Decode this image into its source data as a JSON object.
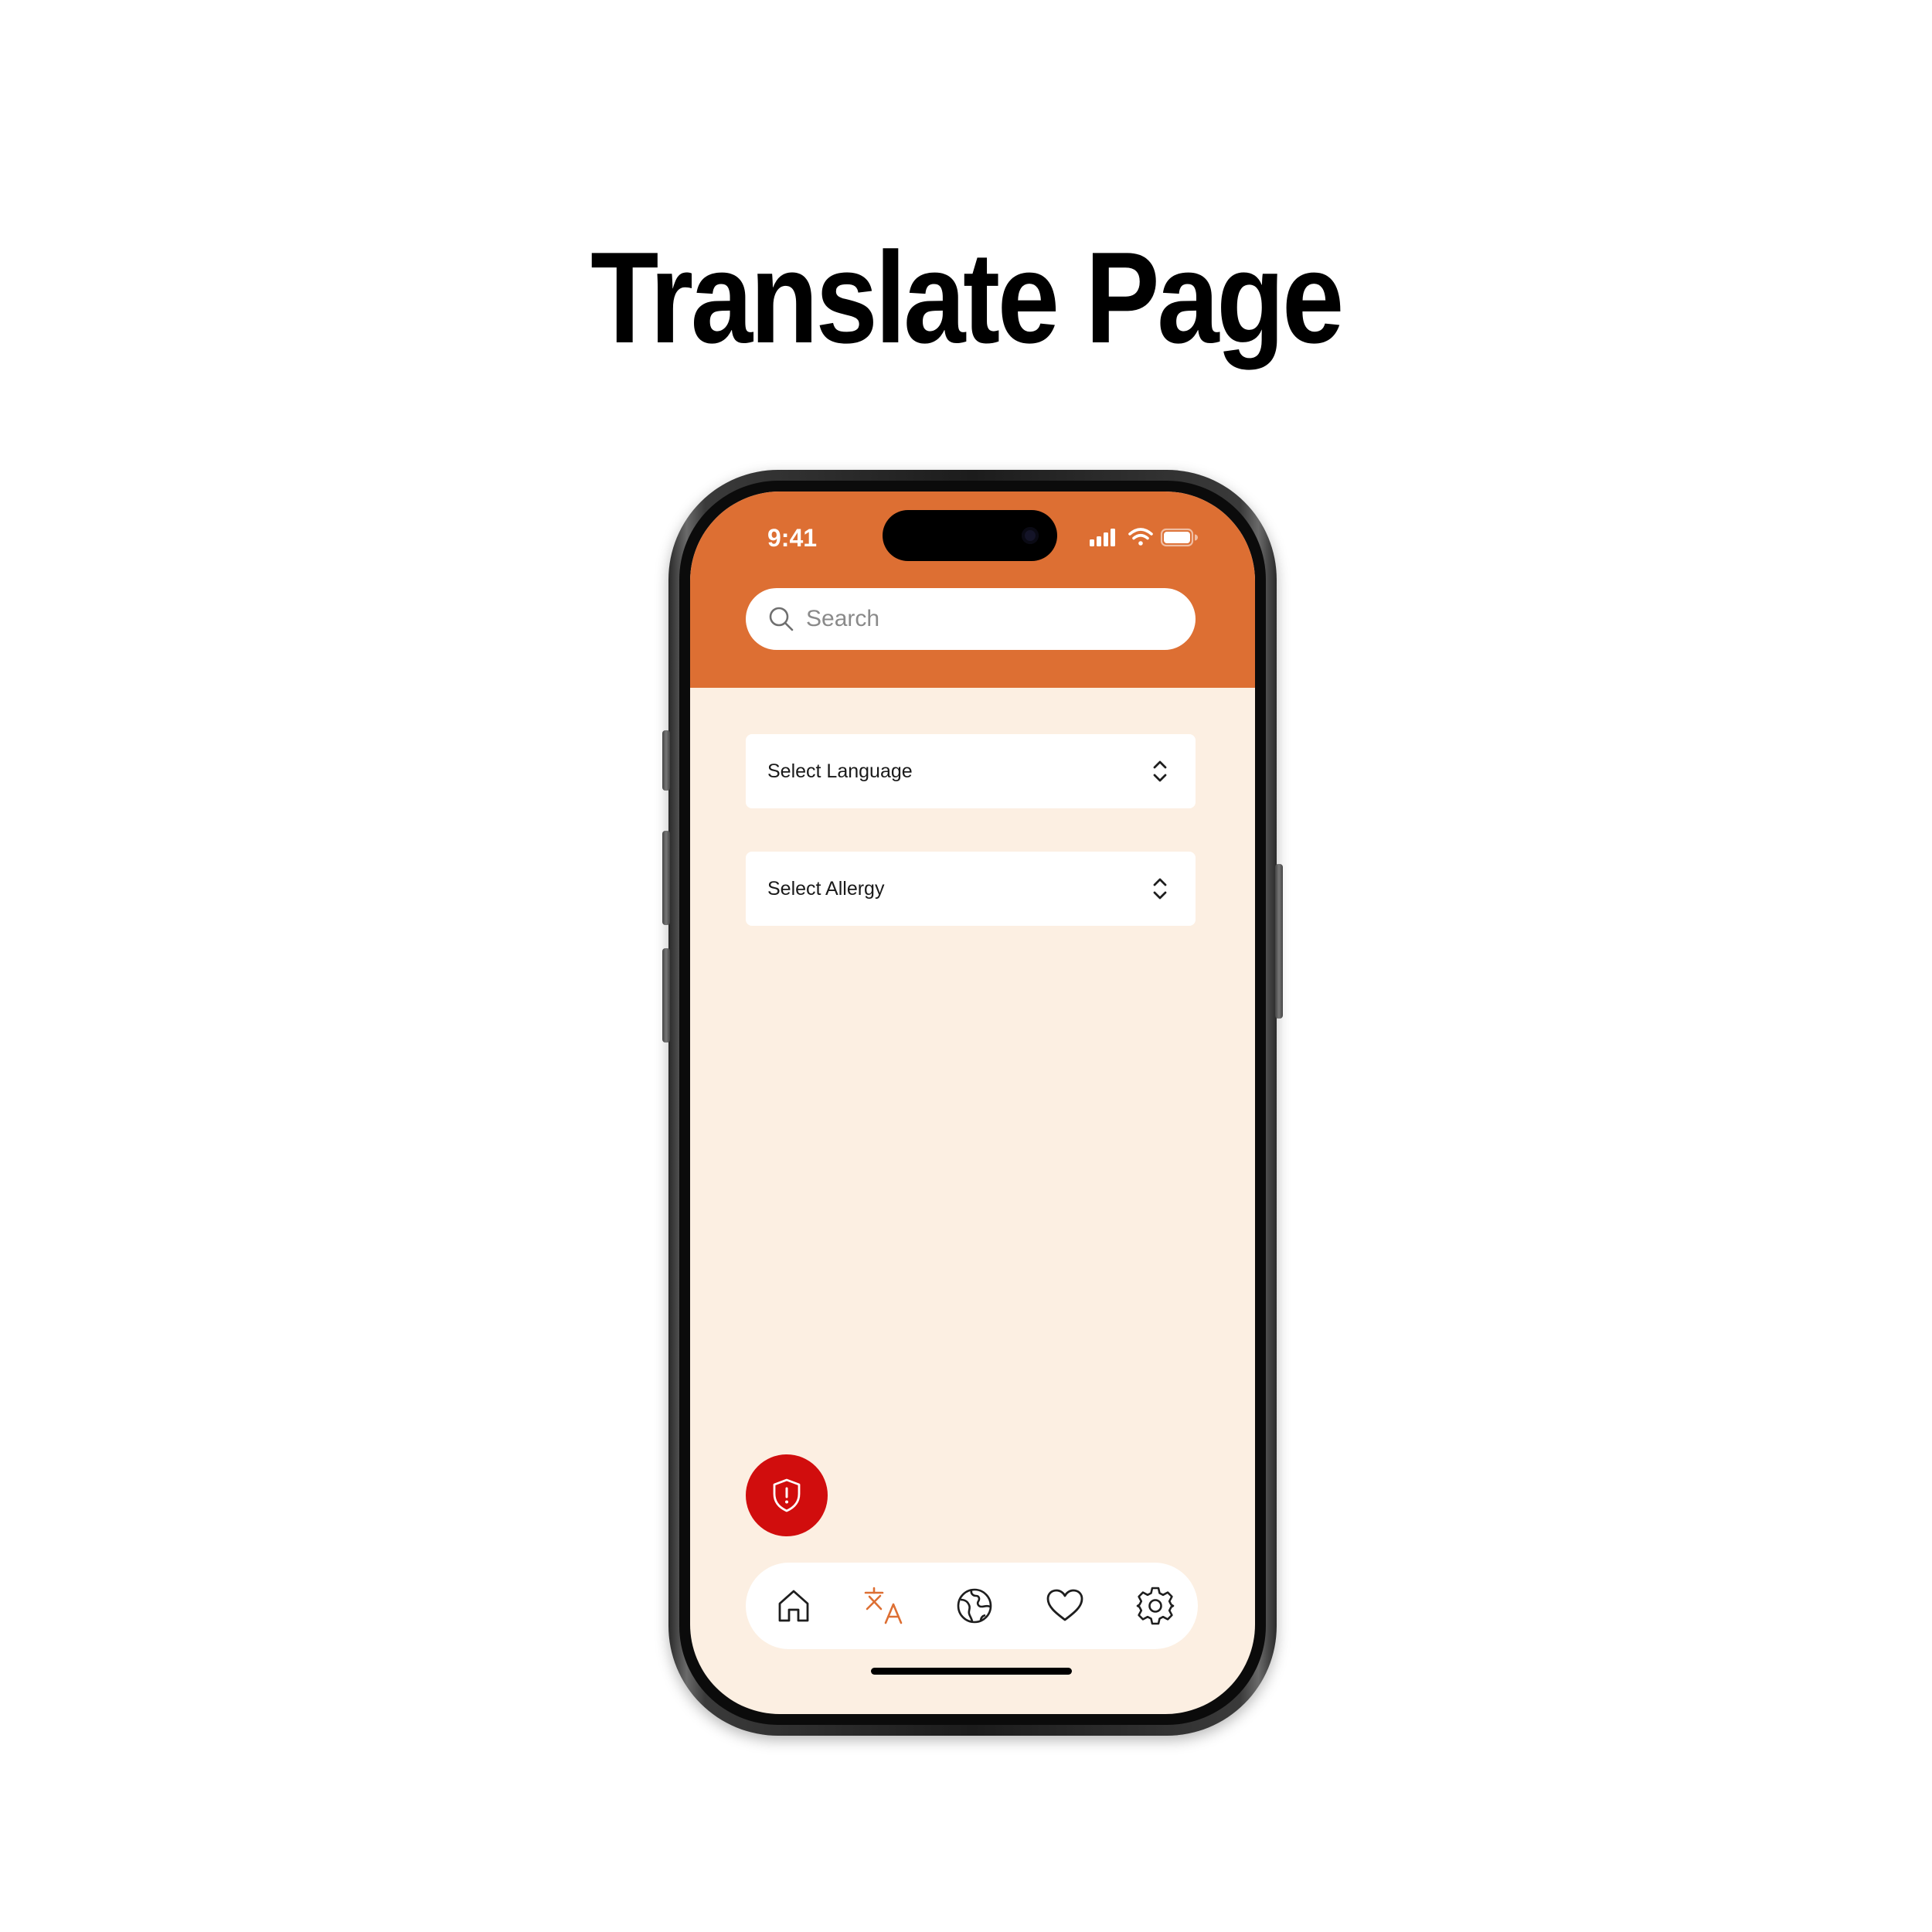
{
  "page": {
    "title": "Translate Page"
  },
  "status_bar": {
    "time": "9:41"
  },
  "search": {
    "placeholder": "Search"
  },
  "selects": {
    "language_label": "Select Language",
    "allergy_label": "Select Allergy"
  },
  "fab": {
    "icon": "shield-alert-icon",
    "color": "#d10d0d"
  },
  "tab_bar": {
    "active": "translate",
    "items": [
      {
        "id": "home",
        "icon": "home-icon"
      },
      {
        "id": "translate",
        "icon": "translate-icon"
      },
      {
        "id": "globe",
        "icon": "globe-icon"
      },
      {
        "id": "favorites",
        "icon": "heart-icon"
      },
      {
        "id": "settings",
        "icon": "gear-icon"
      }
    ]
  },
  "colors": {
    "header": "#dd6f33",
    "background": "#fcefe2",
    "active_tab": "#dd6f33",
    "icon": "#1e1e1e"
  }
}
